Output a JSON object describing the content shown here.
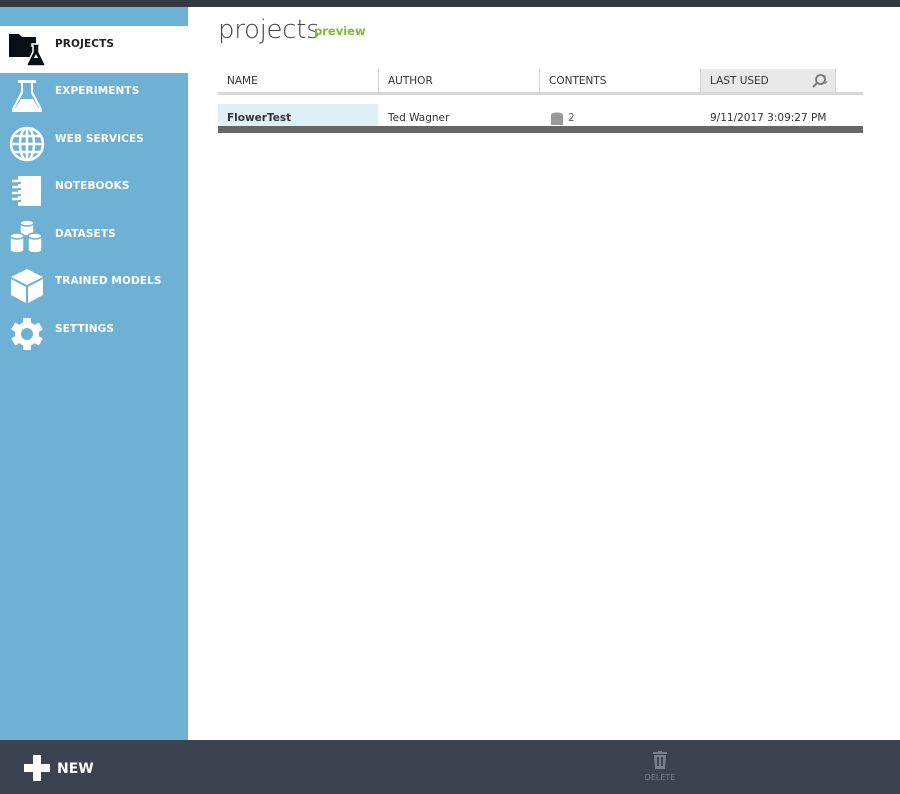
{
  "sidebar": {
    "items": [
      {
        "label": "PROJECTS",
        "icon": "projects-icon",
        "active": true
      },
      {
        "label": "EXPERIMENTS",
        "icon": "flask-icon",
        "active": false
      },
      {
        "label": "WEB SERVICES",
        "icon": "globe-icon",
        "active": false
      },
      {
        "label": "NOTEBOOKS",
        "icon": "notebook-icon",
        "active": false
      },
      {
        "label": "DATASETS",
        "icon": "datasets-icon",
        "active": false
      },
      {
        "label": "TRAINED MODELS",
        "icon": "cube-icon",
        "active": false
      },
      {
        "label": "SETTINGS",
        "icon": "gear-icon",
        "active": false
      }
    ]
  },
  "header": {
    "title": "projects",
    "subtitle": "preview"
  },
  "table": {
    "columns": [
      "NAME",
      "AUTHOR",
      "CONTENTS",
      "LAST USED"
    ],
    "sorted_column": "LAST USED",
    "sort_direction": "descending",
    "rows": [
      {
        "name": "FlowerTest",
        "author": "Ted Wagner",
        "contents": "2",
        "last_used": "9/11/2017 3:09:27 PM"
      }
    ]
  },
  "bottombar": {
    "new_label": "NEW",
    "delete_label": "DELETE"
  },
  "colors": {
    "sidebar": "#6eb1d4",
    "bottombar": "#3c4350",
    "accent_green": "#7cbd2e",
    "selected_row": "#dff0f9"
  }
}
